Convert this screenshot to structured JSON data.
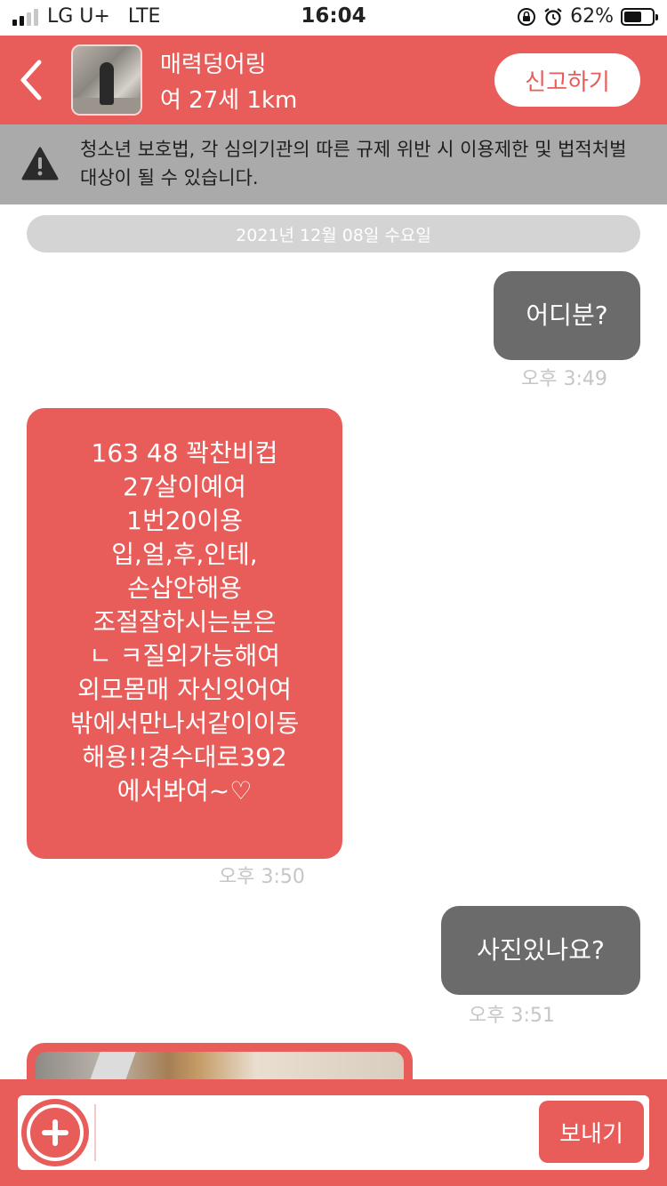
{
  "status_bar": {
    "carrier": "LG U+",
    "network": "LTE",
    "time": "16:04",
    "battery": "62%",
    "battery_level": 0.62,
    "icons": [
      "signal-icon",
      "rotation-lock-icon",
      "alarm-icon",
      "battery-icon"
    ]
  },
  "header": {
    "back_icon": "chevron-left-icon",
    "profile_name": "매력덩어링",
    "profile_meta": "여 27세 1km",
    "report_label": "신고하기",
    "accent_color": "#e85c59"
  },
  "warning": {
    "icon": "warning-icon",
    "text": "청소년 보호법, 각 심의기관의 따른 규제 위반 시 이용제한 및 법적처벌 대상이 될 수 있습니다."
  },
  "chat": {
    "date": "2021년 12월 08일 수요일",
    "messages": [
      {
        "direction": "sent",
        "text": "어디분?",
        "time": "오후 3:49"
      },
      {
        "direction": "received",
        "lines": [
          "163  48  꽉찬비컵",
          "27살이예여",
          "1번20이용",
          "입,얼,후,인테,",
          "손삽안해용",
          "조절잘하시는분은",
          "ㄴ ㅋ질외가능해여",
          "외모몸매 자신잇어여",
          "밖에서만나서같이이동",
          "해용!!경수대로392",
          "에서봐여~♡"
        ],
        "time": "오후 3:50"
      },
      {
        "direction": "sent",
        "text": "사진있나요?",
        "time": "오후 3:51"
      },
      {
        "direction": "received",
        "type": "photo"
      }
    ]
  },
  "input_bar": {
    "plus_icon": "plus-icon",
    "message_value": "",
    "message_placeholder": "",
    "send_label": "보내기"
  }
}
